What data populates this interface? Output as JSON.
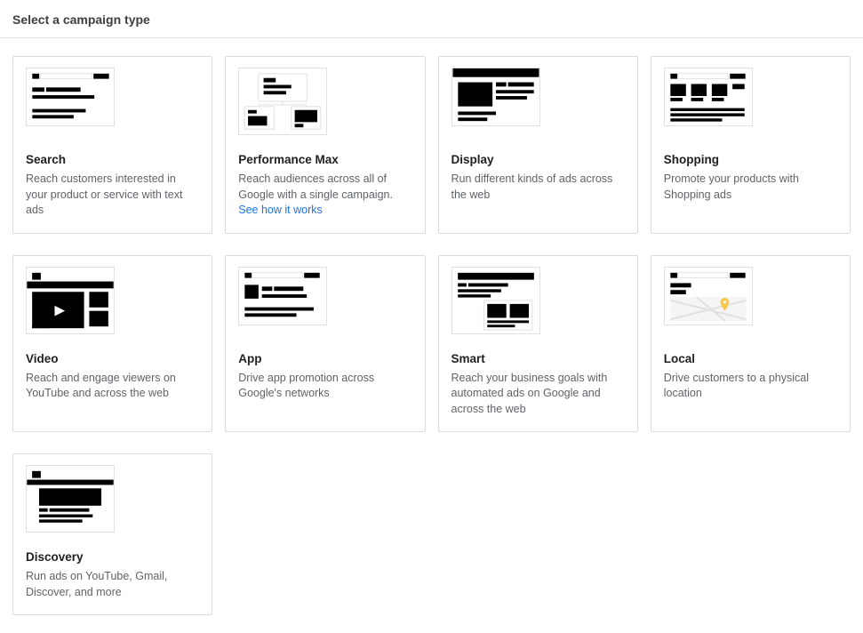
{
  "header": {
    "title": "Select a campaign type"
  },
  "cards": {
    "search": {
      "title": "Search",
      "desc": "Reach customers interested in your product or service with text ads"
    },
    "pmax": {
      "title": "Performance Max",
      "desc_pre": "Reach audiences across all of Google with a single campaign. ",
      "link": "See how it works"
    },
    "display": {
      "title": "Display",
      "desc": "Run different kinds of ads across the web"
    },
    "shopping": {
      "title": "Shopping",
      "desc": "Promote your products with Shopping ads"
    },
    "video": {
      "title": "Video",
      "desc": "Reach and engage viewers on YouTube and across the web"
    },
    "app": {
      "title": "App",
      "desc": "Drive app promotion across Google's networks"
    },
    "smart": {
      "title": "Smart",
      "desc": "Reach your business goals with automated ads on Google and across the web"
    },
    "local": {
      "title": "Local",
      "desc": "Drive customers to a physical location"
    },
    "discovery": {
      "title": "Discovery",
      "desc": "Run ads on YouTube, Gmail, Discover, and more"
    }
  }
}
